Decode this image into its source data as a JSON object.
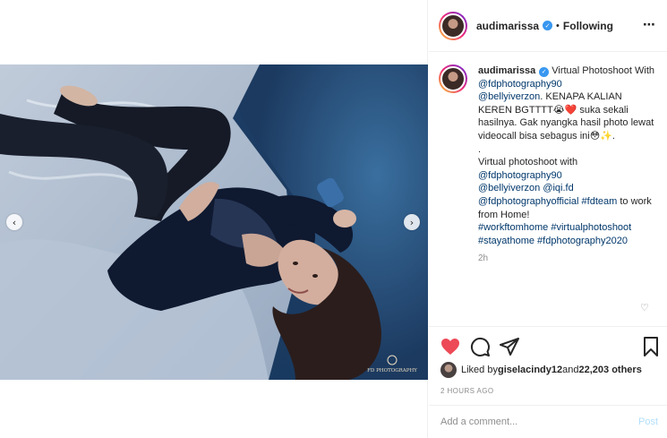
{
  "header": {
    "username": "audimarissa",
    "verified_icon": "verified-badge-icon",
    "separator": "•",
    "follow_status": "Following",
    "more_icon": "⋯"
  },
  "photo": {
    "watermark": "FD PHOTOGRAPHY",
    "prev_icon": "‹",
    "next_icon": "›"
  },
  "caption": {
    "username": "audimarissa",
    "text_1": " Virtual Photoshoot With ",
    "mention_1": "@fdphotography90",
    "mention_2": "@bellyiverzon",
    "text_2": ". KENAPA KALIAN KEREN BGTTTT😭❤️ suka sekali hasilnya. Gak nyangka hasil photo lewat videocall bisa sebagus ini😳✨.",
    "dot": ".",
    "text_3": "Virtual photoshoot with",
    "mention_3": "@fdphotography90",
    "mention_4": "@bellyiverzon",
    "mention_5": "@iqi.fd",
    "mention_6": "@fdphotographyofficial",
    "hashtag_1": "#fdteam",
    "text_4": " to work from Home!",
    "hashtag_2": "#workftomhome",
    "hashtag_3": "#virtualphotoshoot",
    "hashtag_4": "#stayathome",
    "hashtag_5": "#fdphotography2020",
    "time": "2h",
    "like_icon": "♡"
  },
  "actions": {
    "like_icon": "heart-filled-icon",
    "comment_icon": "comment-icon",
    "share_icon": "share-icon",
    "save_icon": "bookmark-icon",
    "like_color": "#ed4956"
  },
  "likes": {
    "prefix": "Liked by ",
    "user": "giselacindy12",
    "middle": " and ",
    "count": "22,203 others"
  },
  "posted_ago": "2 HOURS AGO",
  "comment": {
    "placeholder": "Add a comment...",
    "post_label": "Post"
  }
}
